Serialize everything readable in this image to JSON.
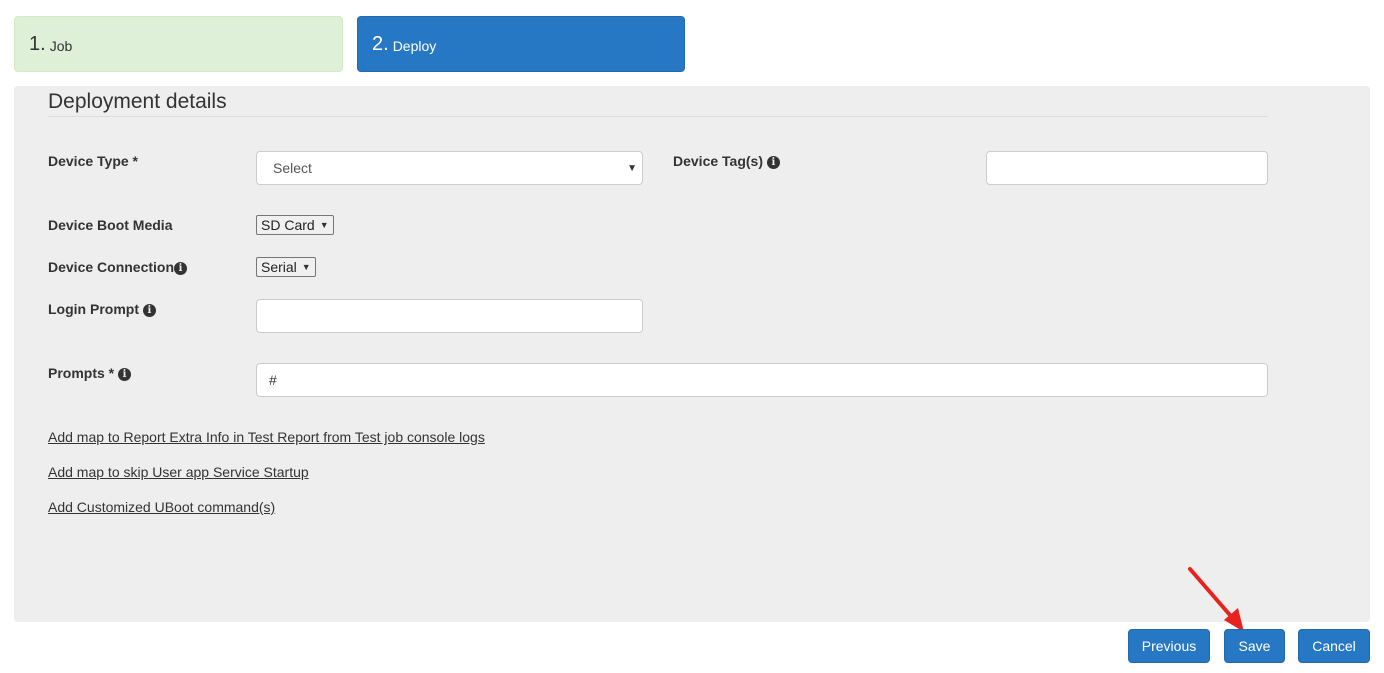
{
  "steps": [
    {
      "number": "1.",
      "label": "Job"
    },
    {
      "number": "2.",
      "label": "Deploy"
    }
  ],
  "panel": {
    "title": "Deployment details"
  },
  "fields": {
    "device_type": {
      "label": "Device Type *",
      "value": "Select"
    },
    "device_tags": {
      "label": "Device Tag(s)",
      "value": ""
    },
    "boot_media": {
      "label": "Device Boot Media",
      "value": "SD Card"
    },
    "connection": {
      "label": "Device Connection",
      "value": "Serial"
    },
    "login_prompt": {
      "label": "Login Prompt",
      "value": ""
    },
    "prompts": {
      "label": "Prompts *",
      "value": "#"
    }
  },
  "links": [
    "Add map to Report Extra Info in Test Report from Test job console logs",
    "Add map to skip User app Service Startup",
    "Add Customized UBoot command(s)"
  ],
  "buttons": {
    "previous": "Previous",
    "save": "Save",
    "cancel": "Cancel"
  },
  "icons": {
    "info": "i"
  },
  "colors": {
    "primary": "#2778c4",
    "step_done": "#dff0d8",
    "annotation_arrow": "#e8221f"
  }
}
